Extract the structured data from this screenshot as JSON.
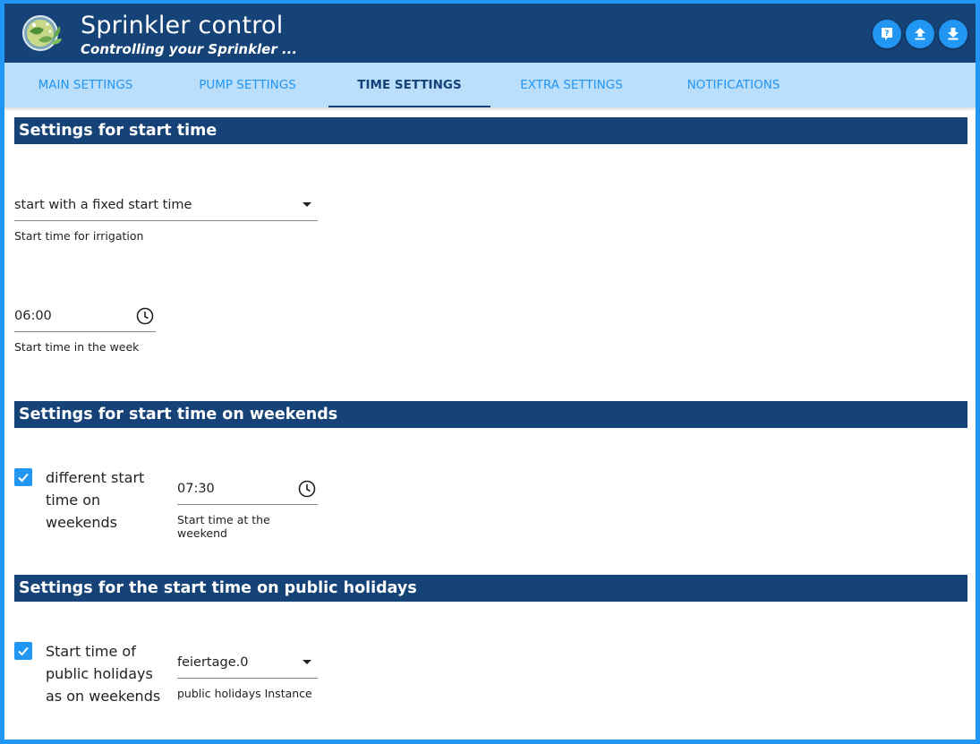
{
  "header": {
    "title": "Sprinkler control",
    "subtitle": "Controlling your Sprinkler ...",
    "buttons": [
      {
        "name": "help-icon"
      },
      {
        "name": "upload-icon"
      },
      {
        "name": "download-icon"
      }
    ],
    "accent_color": "#164377",
    "button_color": "#2196f3"
  },
  "tabs": [
    {
      "label": "MAIN SETTINGS",
      "active": false
    },
    {
      "label": "PUMP SETTINGS",
      "active": false
    },
    {
      "label": "TIME SETTINGS",
      "active": true
    },
    {
      "label": "EXTRA SETTINGS",
      "active": false
    },
    {
      "label": "NOTIFICATIONS",
      "active": false
    }
  ],
  "sections": {
    "start_time": {
      "title": "Settings for start time",
      "mode_select": {
        "value": "start with a fixed start time",
        "helper": "Start time for irrigation"
      },
      "week_time": {
        "value": "06:00",
        "helper": "Start time in the week"
      }
    },
    "weekends": {
      "title": "Settings for start time on weekends",
      "checkbox": {
        "label": "different start time on weekends",
        "checked": true
      },
      "weekend_time": {
        "value": "07:30",
        "helper": "Start time at the weekend"
      }
    },
    "holidays": {
      "title": "Settings for the start time on public holidays",
      "checkbox": {
        "label": "Start time of public holidays as on weekends",
        "checked": true
      },
      "instance_select": {
        "value": "feiertage.0",
        "helper": "public holidays Instance"
      }
    }
  }
}
